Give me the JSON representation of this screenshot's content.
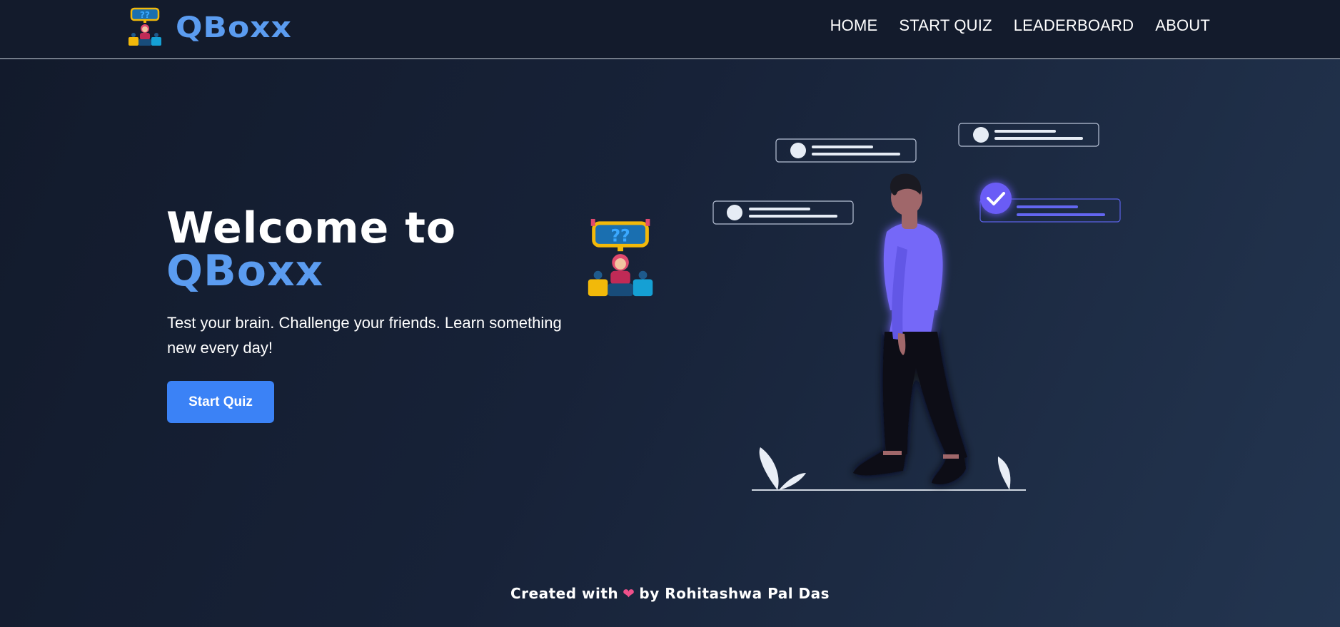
{
  "brand": {
    "name": "QBoxx",
    "logo_icon": "quiz-host-icon"
  },
  "nav": {
    "items": [
      {
        "label": "HOME"
      },
      {
        "label": "START QUIZ"
      },
      {
        "label": "LEADERBOARD"
      },
      {
        "label": "ABOUT"
      }
    ]
  },
  "hero": {
    "title_line1": "Welcome to",
    "title_line2": "QBoxx",
    "subtitle": "Test your brain. Challenge your friends. Learn something new every day!",
    "cta_label": "Start Quiz",
    "illustration_icon": "person-with-chat-bubbles-illustration"
  },
  "footer": {
    "prefix": "Created with",
    "heart_icon": "❤",
    "suffix": "by Rohitashwa Pal Das"
  },
  "colors": {
    "accent": "#5b9cf0",
    "button": "#3b82f6",
    "shirt": "#7468f8",
    "background": "#172238"
  }
}
